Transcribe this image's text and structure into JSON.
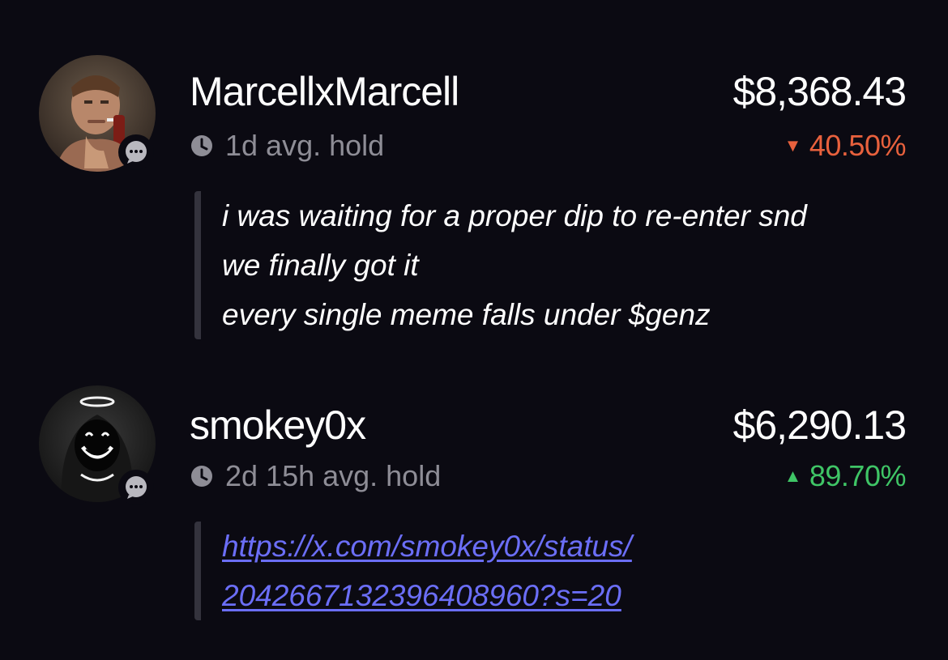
{
  "entries": [
    {
      "username": "MarcellxMarcell",
      "amount": "$8,368.43",
      "hold": "1d avg. hold",
      "change": "40.50%",
      "change_direction": "down",
      "change_color": "#e8613d",
      "avatar_icon": "user-avatar",
      "badge_icon": "chat-bubble-icon",
      "comment_lines": [
        "i was waiting for a proper dip to re-enter snd",
        "we finally got it",
        "every single meme falls under $genz"
      ]
    },
    {
      "username": "smokey0x",
      "amount": "$6,290.13",
      "hold": "2d 15h avg. hold",
      "change": "89.70%",
      "change_direction": "up",
      "change_color": "#3fc566",
      "avatar_icon": "user-avatar",
      "badge_icon": "chat-bubble-icon",
      "comment_link_lines": [
        "https://x.com/smokey0x/status/",
        "2042667132396408960?s=20"
      ]
    }
  ],
  "colors": {
    "background": "#0b0a12",
    "text": "#ffffff",
    "muted": "#8e8d96",
    "link": "#6b6ef7",
    "quote_bar": "#34333d"
  }
}
